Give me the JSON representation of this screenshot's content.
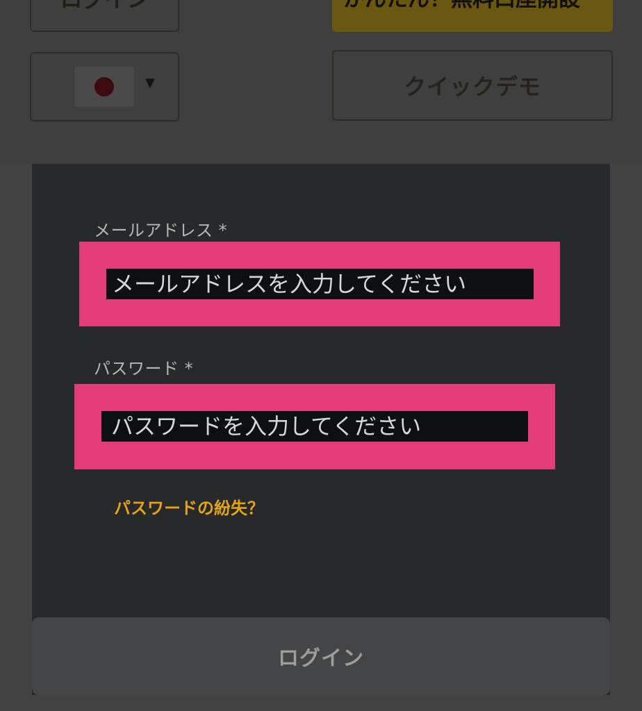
{
  "header": {
    "login_label": "ログイン",
    "open_account_label": "かんたん！無料口座開設",
    "quick_demo_label": "クイックデモ",
    "dropdown_icon": "▼"
  },
  "form": {
    "email": {
      "label": "メールアドレス *",
      "placeholder": "メールアドレスを入力してください"
    },
    "password": {
      "label": "パスワード *",
      "placeholder": "パスワードを入力してください"
    },
    "forgot_password_label": "パスワードの紛失？",
    "login_button_label": "ログイン"
  }
}
